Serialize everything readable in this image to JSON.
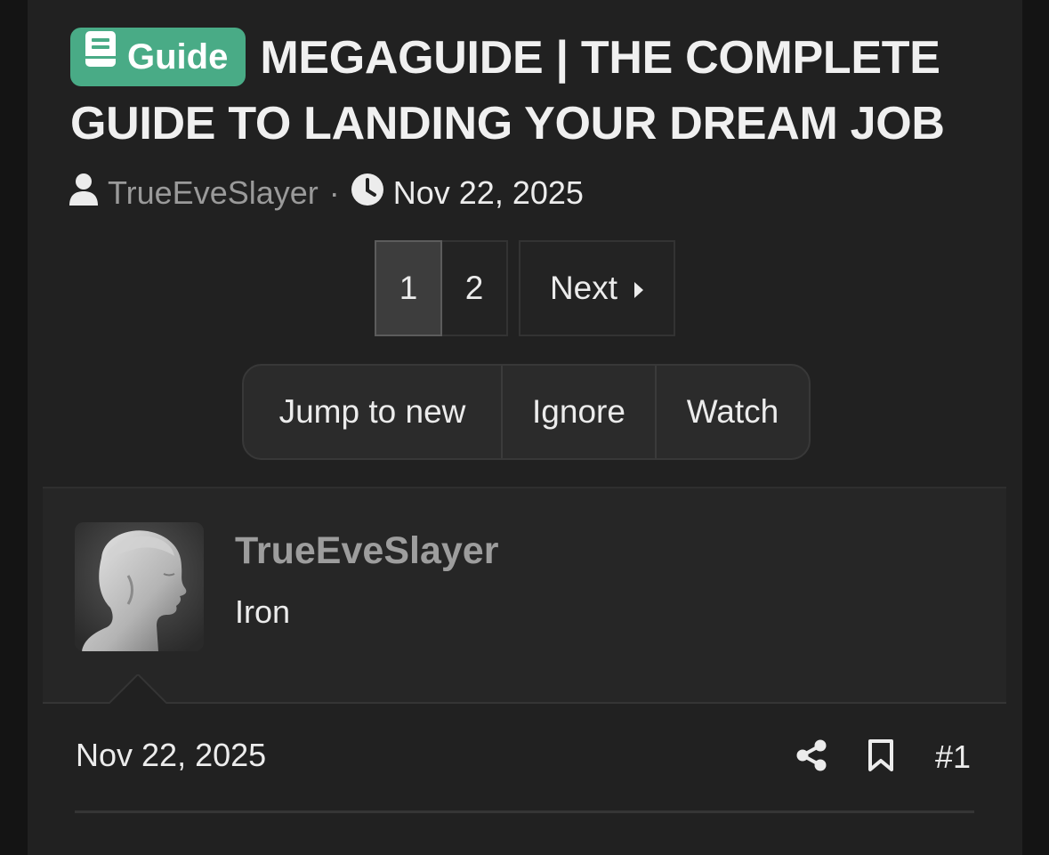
{
  "thread": {
    "prefix_label": "Guide",
    "title": "MEGAGUIDE | THE COMPLETE GUIDE TO LANDING YOUR DREAM JOB",
    "author": "TrueEveSlayer",
    "separator": "·",
    "start_date": "Nov 22, 2025",
    "prefix_color": "#49ab86"
  },
  "pagination": {
    "current_page": "1",
    "page_2": "2",
    "next_label": "Next",
    "caret": "▸"
  },
  "actions": {
    "jump_label": "Jump to new",
    "ignore_label": "Ignore",
    "watch_label": "Watch"
  },
  "post": {
    "username": "TrueEveSlayer",
    "user_title": "Iron",
    "date": "Nov 22, 2025",
    "number": "#1",
    "icons": [
      "user-icon",
      "clock-icon",
      "book-icon",
      "share-icon",
      "bookmark-icon"
    ]
  }
}
